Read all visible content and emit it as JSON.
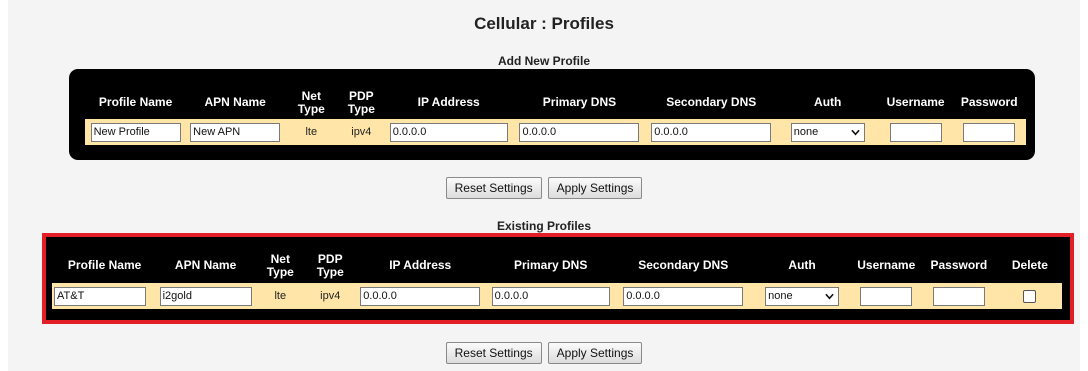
{
  "page": {
    "title": "Cellular : Profiles"
  },
  "add_new": {
    "section_title": "Add New Profile",
    "headers": [
      "Profile Name",
      "APN Name",
      "Net\nType",
      "PDP\nType",
      "IP Address",
      "Primary DNS",
      "Secondary DNS",
      "Auth",
      "Username",
      "Password"
    ],
    "row": {
      "profile_name": "New Profile",
      "apn_name": "New APN",
      "net_type": "lte",
      "pdp_type": "ipv4",
      "ip_address": "0.0.0.0",
      "primary_dns": "0.0.0.0",
      "secondary_dns": "0.0.0.0",
      "auth": "none",
      "username": "",
      "password": ""
    },
    "buttons": {
      "reset": "Reset Settings",
      "apply": "Apply Settings"
    }
  },
  "existing": {
    "section_title": "Existing Profiles",
    "headers": [
      "Profile Name",
      "APN Name",
      "Net\nType",
      "PDP\nType",
      "IP Address",
      "Primary DNS",
      "Secondary DNS",
      "Auth",
      "Username",
      "Password",
      "Delete"
    ],
    "rows": [
      {
        "profile_name": "AT&T",
        "apn_name": "i2gold",
        "net_type": "lte",
        "pdp_type": "ipv4",
        "ip_address": "0.0.0.0",
        "primary_dns": "0.0.0.0",
        "secondary_dns": "0.0.0.0",
        "auth": "none",
        "username": "",
        "password": "",
        "delete_checked": false
      }
    ],
    "buttons": {
      "reset": "Reset Settings",
      "apply": "Apply Settings"
    }
  },
  "colors": {
    "panel_bg": "#000000",
    "row_bg": "#ffe6a8",
    "highlight_border": "#e21f26",
    "page_bg": "#f4f4f4"
  },
  "icons": {
    "auth_dropdown": "chevron-down-icon"
  }
}
